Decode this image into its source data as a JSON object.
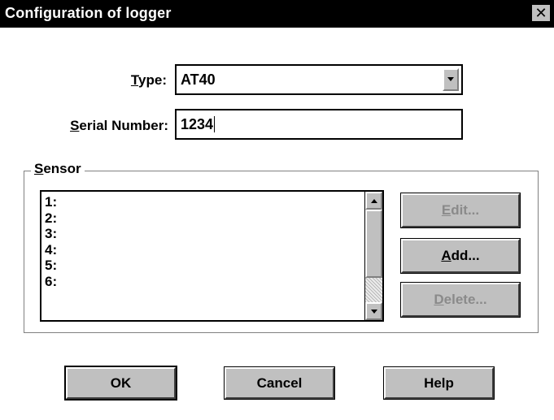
{
  "window": {
    "title": "Configuration of logger",
    "close_glyph": "✕"
  },
  "form": {
    "type_label_mnemonic": "T",
    "type_label_rest": "ype:",
    "type_value": "AT40",
    "serial_label_mnemonic": "S",
    "serial_label_rest": "erial Number:",
    "serial_value": "1234"
  },
  "sensor": {
    "group_label_mnemonic": "S",
    "group_label_rest": "ensor",
    "items": [
      "1:",
      "2:",
      "3:",
      "4:",
      "5:",
      "6:"
    ],
    "buttons": {
      "edit_mnemonic": "E",
      "edit_rest": "dit...",
      "add_mnemonic": "A",
      "add_rest": "dd...",
      "delete_mnemonic": "D",
      "delete_rest": "elete..."
    }
  },
  "footer": {
    "ok_label": "OK",
    "cancel_label": "Cancel",
    "help_label": "Help"
  },
  "icons": {
    "dropdown": "chevron-down-icon",
    "scroll_up": "arrow-up-icon",
    "scroll_down": "arrow-down-icon",
    "close": "close-icon"
  },
  "colors": {
    "titlebar": "#000000",
    "face": "#c0c0c0",
    "window": "#ffffff",
    "disabled_text": "#8a8a8a"
  }
}
